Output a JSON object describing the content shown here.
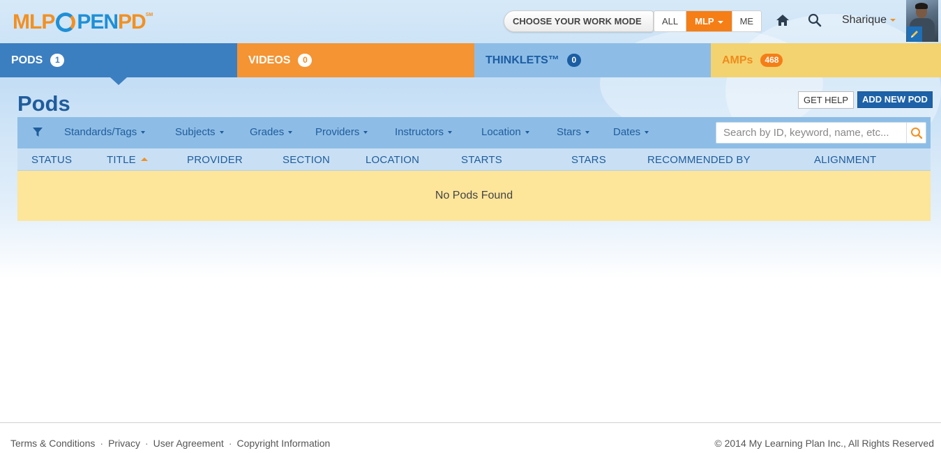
{
  "brand": {
    "logo_left": "MLP",
    "logo_right": "PENPD",
    "logo_mark": "SM"
  },
  "header": {
    "mode_label": "CHOOSE YOUR WORK MODE",
    "modes": [
      {
        "label": "ALL"
      },
      {
        "label": "MLP",
        "active": true
      },
      {
        "label": "ME"
      }
    ],
    "user_name": "Sharique",
    "icons": [
      "home-icon",
      "search-icon"
    ]
  },
  "tabs": [
    {
      "label": "PODS",
      "count": "1",
      "color": "#3c7fc1"
    },
    {
      "label": "VIDEOS",
      "count": "0",
      "color": "#f59433"
    },
    {
      "label": "THINKLETS™",
      "count": "0",
      "color": "#8dbde6"
    },
    {
      "label": "AMPs",
      "count": "468",
      "color": "#f3d36f"
    }
  ],
  "page": {
    "title": "Pods",
    "help_button": "GET HELP",
    "add_button": "ADD NEW POD"
  },
  "filters": [
    "Standards/Tags",
    "Subjects",
    "Grades",
    "Providers",
    "Instructors",
    "Location",
    "Stars",
    "Dates"
  ],
  "search": {
    "placeholder": "Search by ID, keyword, name, etc...",
    "value": ""
  },
  "table": {
    "columns": [
      "STATUS",
      "TITLE",
      "PROVIDER",
      "SECTION",
      "LOCATION",
      "STARTS",
      "STARS",
      "RECOMMENDED BY",
      "ALIGNMENT"
    ],
    "sorted_column": "TITLE",
    "sort_direction": "ascending",
    "empty_message": "No Pods Found"
  },
  "footer": {
    "links": [
      "Terms & Conditions",
      "Privacy",
      "User Agreement",
      "Copyright Information"
    ],
    "copyright": "© 2014 My Learning Plan Inc., All Rights Reserved"
  },
  "colors": {
    "accent_blue": "#1f5c9c",
    "accent_orange": "#f57e16",
    "empty_row": "#fde59a"
  }
}
